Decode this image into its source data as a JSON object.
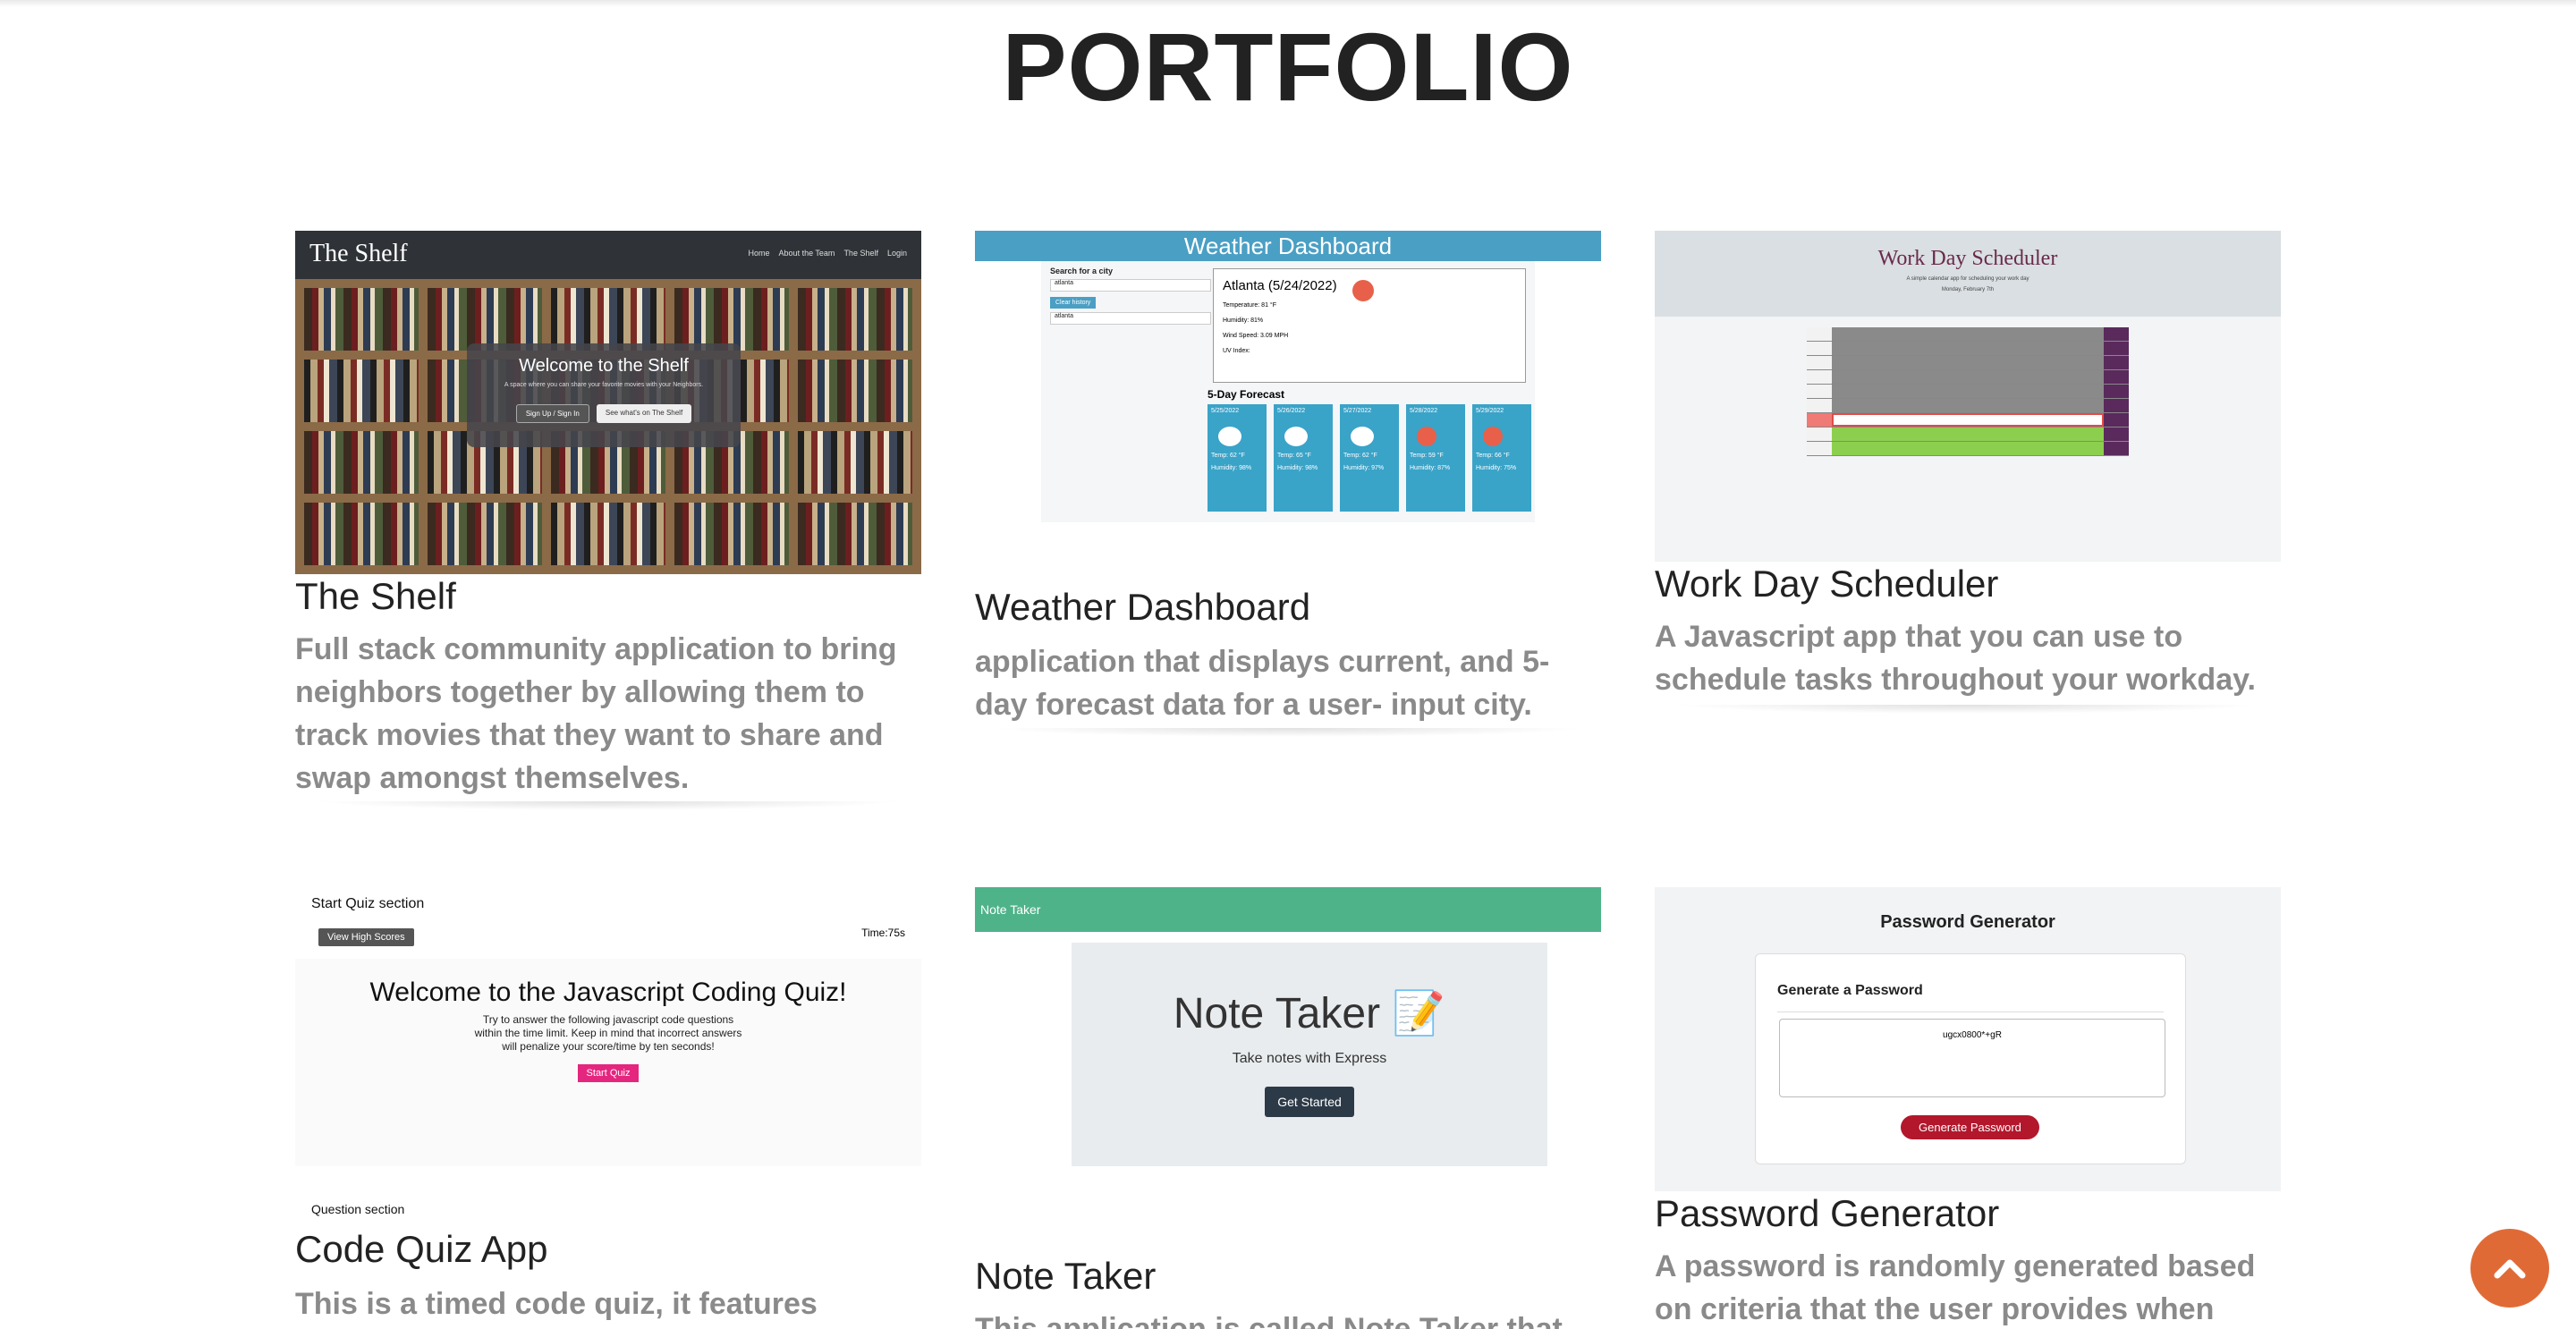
{
  "page": {
    "heading": "PORTFOLIO"
  },
  "projects": [
    {
      "title": "The Shelf",
      "description": "Full stack community application to bring neighbors together by allowing them to track movies that they want to share and swap amongst themselves.",
      "thumb": {
        "brand": "The Shelf",
        "nav": [
          "Home",
          "About the Team",
          "The Shelf",
          "Login"
        ],
        "welcome": "Welcome to the Shelf",
        "tagline": "A space where you can share your favorite movies with your Neighbors.",
        "btn1": "Sign Up / Sign In",
        "btn2": "See what's on The Shelf"
      }
    },
    {
      "title": "Weather Dashboard",
      "description": "application that displays current, and 5-day forecast data for a user- input city.",
      "thumb": {
        "bar": "Weather Dashboard",
        "search_label": "Search for a city",
        "search_value": "atlanta",
        "clear": "Clear history",
        "history": "atlanta",
        "city": "Atlanta (5/24/2022)",
        "temp": "Temperature: 81 °F",
        "humidity": "Humidity: 81%",
        "wind": "Wind Speed: 3.09 MPH",
        "uv": "UV Index:",
        "forecast_label": "5-Day Forecast",
        "days": [
          "5/25/2022",
          "5/26/2022",
          "5/27/2022",
          "5/28/2022",
          "5/29/2022"
        ],
        "day_temps": [
          "Temp: 62 °F",
          "Temp: 65 °F",
          "Temp: 62 °F",
          "Temp: 59 °F",
          "Temp: 66 °F"
        ],
        "day_humidity": [
          "Humidity: 98%",
          "Humidity: 98%",
          "Humidity: 97%",
          "Humidity: 87%",
          "Humidity: 75%"
        ]
      }
    },
    {
      "title": "Work Day Scheduler",
      "description": "A Javascript app that you can use to schedule tasks throughout your workday.",
      "thumb": {
        "title": "Work Day Scheduler",
        "subtitle": "A simple calendar app for scheduling your work day",
        "date": "Monday, February 7th"
      }
    },
    {
      "title": "Code Quiz App",
      "description": "This is a timed code quiz, it features",
      "thumb": {
        "section": "Start Quiz section",
        "high_scores": "View High Scores",
        "time": "Time:75s",
        "welcome": "Welcome to the Javascript Coding Quiz!",
        "instructions": "Try to answer the following javascript code questions within the time limit. Keep in mind that incorrect answers will penalize your score/time by ten seconds!",
        "start": "Start Quiz",
        "question_section": "Question section"
      }
    },
    {
      "title": "Note Taker",
      "description": "This application is called Note Taker that can",
      "thumb": {
        "bar": "Note Taker",
        "title": "Note Taker 📝",
        "subtitle": "Take notes with Express",
        "button": "Get Started"
      }
    },
    {
      "title": "Password Generator",
      "description": "A password is randomly generated based on criteria that the user provides when",
      "thumb": {
        "title": "Password Generator",
        "card_title": "Generate a Password",
        "password": "ugcx0800*+gR",
        "button": "Generate Password"
      }
    }
  ],
  "icons": {
    "back_to_top": "chevron-up-icon"
  },
  "colors": {
    "accent": "#e06a36",
    "desc_text": "#8a8a8a"
  }
}
